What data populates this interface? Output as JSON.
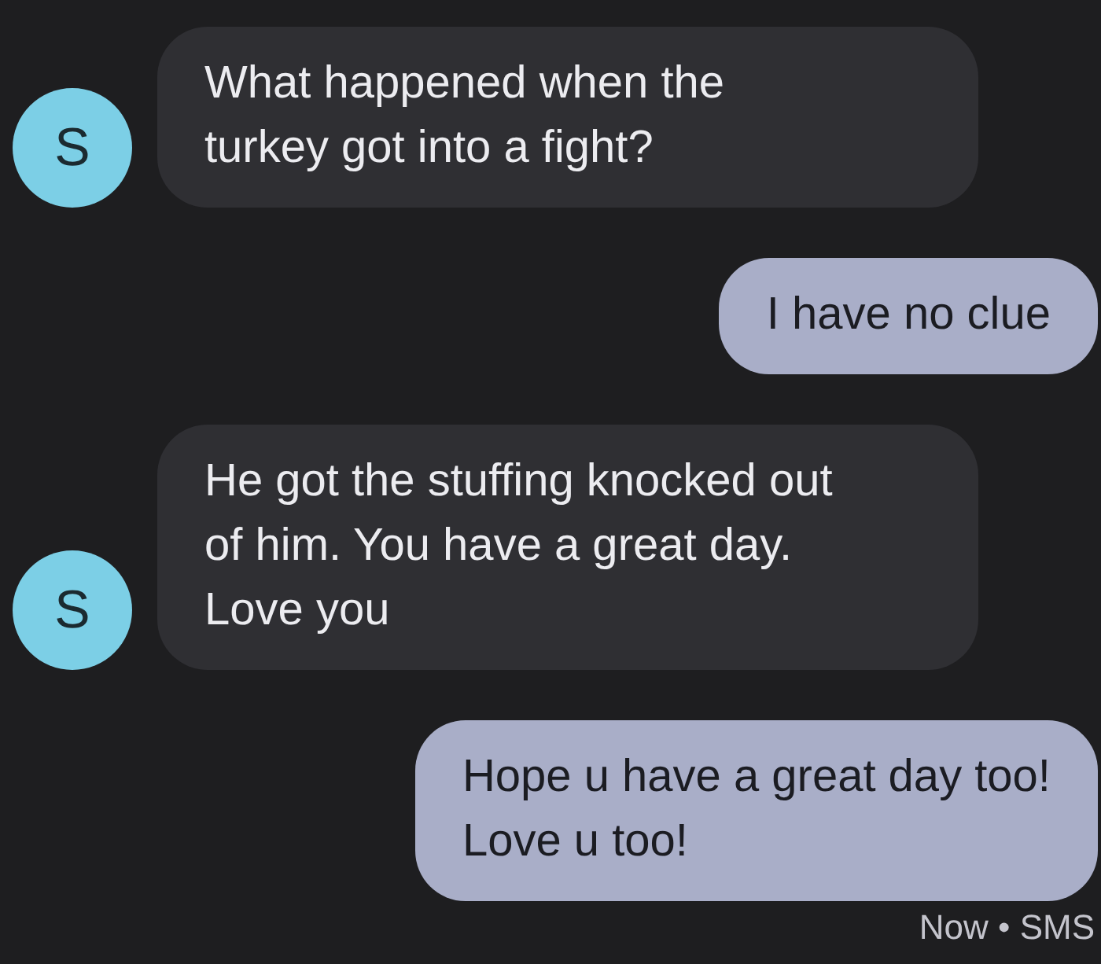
{
  "messages": [
    {
      "kind": "incoming",
      "avatar": "S",
      "text": "What happened when the\nturkey got into a fight?"
    },
    {
      "kind": "outgoing",
      "text": "I have no clue"
    },
    {
      "kind": "incoming",
      "avatar": "S",
      "text": "He got the stuffing knocked out\nof him. You have a great day.\nLove you"
    },
    {
      "kind": "outgoing",
      "text": "Hope u have a great day too!\nLove u too!"
    }
  ],
  "status": "Now • SMS"
}
